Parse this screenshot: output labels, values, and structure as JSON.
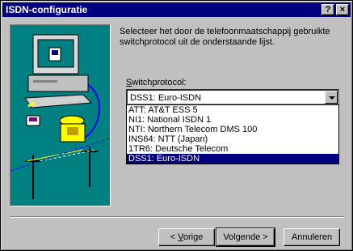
{
  "window": {
    "title": "ISDN-configuratie",
    "help_label": "?",
    "close_label": "×"
  },
  "instructions": "Selecteer het door de telefoonmaatschappij gebruikte switchprotocol uit de onderstaande lijst.",
  "switch_label": {
    "mnemonic": "S",
    "rest": "witchprotocol:"
  },
  "combo": {
    "selected": "DSS1: Euro-ISDN"
  },
  "options": [
    "ATT: AT&T ESS 5",
    "NI1: National ISDN 1",
    "NTI: Northern Telecom DMS 100",
    "INS64: NTT (Japan)",
    "1TR6: Deutsche Telecom",
    "DSS1: Euro-ISDN"
  ],
  "buttons": {
    "back": {
      "prefix": "< ",
      "mnemonic": "V",
      "rest": "orige"
    },
    "next": "Volgende >",
    "cancel": "Annuleren"
  }
}
